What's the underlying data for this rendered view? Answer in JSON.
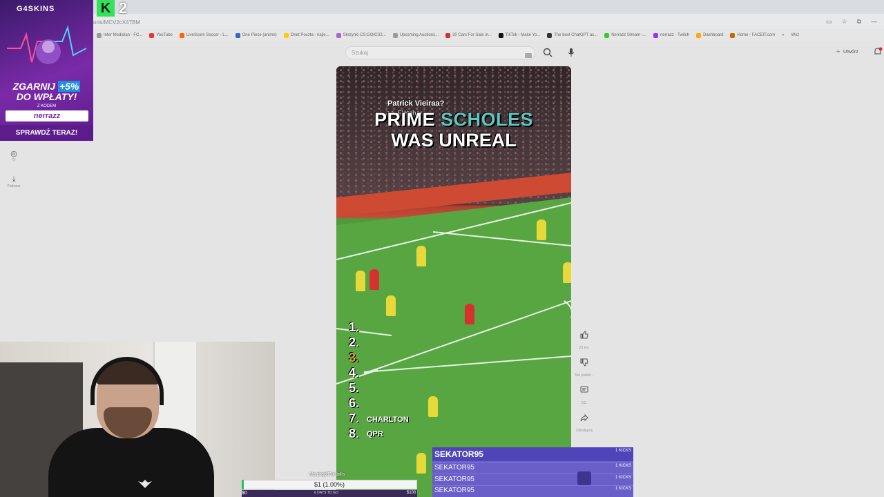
{
  "browser": {
    "url": "orts/MCV2cX47BM",
    "bookmarks": [
      "Inter Mediolan - FC...",
      "YouTube",
      "LiveScore Soccer - L...",
      "One Piece (anime)",
      "Onet Poczta - najle...",
      "Skrzynki CS:GO/CS2...",
      "Upcoming Auctions...",
      "20 Cars For Sale in...",
      "TikTok - Make Yo...",
      "The best ChatGPT as...",
      "Nerrazz Stream -...",
      "nerrazz - Twitch",
      "Dashboard",
      "Home - FACEIT.com"
    ],
    "bookmarks_more": "»",
    "bookmarks_extra": "Wsz"
  },
  "youtube": {
    "search_placeholder": "Szukaj",
    "create_label": "Utwórz",
    "sidebar": [
      {
        "icon": "account-icon",
        "label": "Ty"
      },
      {
        "icon": "download-icon",
        "label": "Pobrane"
      }
    ],
    "actions": [
      {
        "icon": "thumbs-up-icon",
        "label": "23 tys."
      },
      {
        "icon": "thumbs-down-icon",
        "label": "Nie podob..."
      },
      {
        "icon": "comment-icon",
        "label": "811"
      },
      {
        "icon": "share-icon",
        "label": "Udostępnij"
      }
    ]
  },
  "video": {
    "question": "Patrick Vieiraa?",
    "note": ">> Fletcher",
    "title_word1": "PRIME",
    "title_word2": "SCHOLES",
    "title_line2": "WAS UNREAL",
    "ranks": [
      "1.",
      "2.",
      "3.",
      "4.",
      "5.",
      "6.",
      "7.",
      "8."
    ],
    "rank_names": {
      "7": "CHARLTON",
      "8": "QPR"
    }
  },
  "overlay_ad": {
    "brand": "G4SKINS",
    "line1": "ZGARNIJ",
    "percent": "+5%",
    "line2": "DO WPŁATY!",
    "small": "Z KODEM",
    "code": "nerrazz",
    "cta": "SPRAWDŹ TERAZ!"
  },
  "kick_badge": {
    "letter": "K",
    "number": "2"
  },
  "goal": {
    "label": "Na prąd/For bills",
    "value_text": "$1 (1.00%)",
    "progress_pct": 1,
    "min": "$0",
    "max": "$100",
    "sub": "6 DAYS TO GO"
  },
  "kicks_feed": {
    "top_user": "SEKATOR95",
    "top_amount": "1 KICKS",
    "rows": [
      {
        "user": "SEKATOR95",
        "amount": "1 KICKS"
      },
      {
        "user": "SEKATOR95",
        "amount": "1 KICKS"
      },
      {
        "user": "SEKATOR95",
        "amount": "1 KICKS"
      }
    ]
  },
  "colors": {
    "kick_green": "#35e05a",
    "feed_purple": "#6a5ec9",
    "title_accent": "#5fc6c0"
  }
}
